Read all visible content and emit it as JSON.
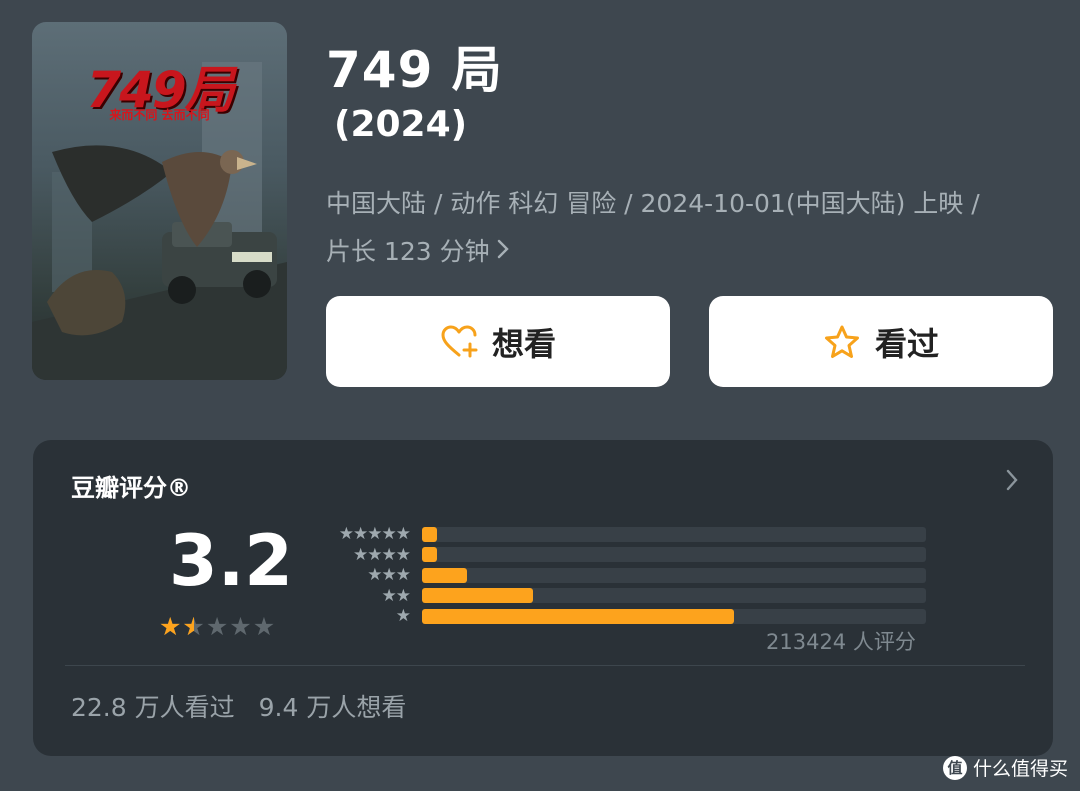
{
  "poster": {
    "title": "749局",
    "tagline": "来而不同 去而不同"
  },
  "movie": {
    "title": "749 局",
    "year": "(2024)",
    "meta_line1": "中国大陆 / 动作 科幻 冒险 / 2024-10-01(中国大陆) 上映 /",
    "meta_line2": "片长 123 分钟"
  },
  "actions": {
    "want_label": "想看",
    "seen_label": "看过"
  },
  "rating": {
    "header": "豆瓣评分®",
    "score": "3.2",
    "star_value": 1.5,
    "distribution": [
      {
        "stars": "★★★★★",
        "fraction": 0.03
      },
      {
        "stars": "★★★★",
        "fraction": 0.03
      },
      {
        "stars": "★★★",
        "fraction": 0.09
      },
      {
        "stars": "★★",
        "fraction": 0.22
      },
      {
        "stars": "★",
        "fraction": 0.62
      }
    ],
    "count_text": "213424 人评分",
    "seen_text": "22.8 万人看过",
    "want_text": "9.4 万人想看"
  },
  "watermark": {
    "logo": "值",
    "text": "什么值得买"
  },
  "colors": {
    "background": "#3e474f",
    "card": "#2a3137",
    "accent": "#fda31d",
    "button": "#ffffff"
  },
  "icons": [
    "heart-plus-icon",
    "star-outline-icon",
    "chevron-right-icon"
  ]
}
